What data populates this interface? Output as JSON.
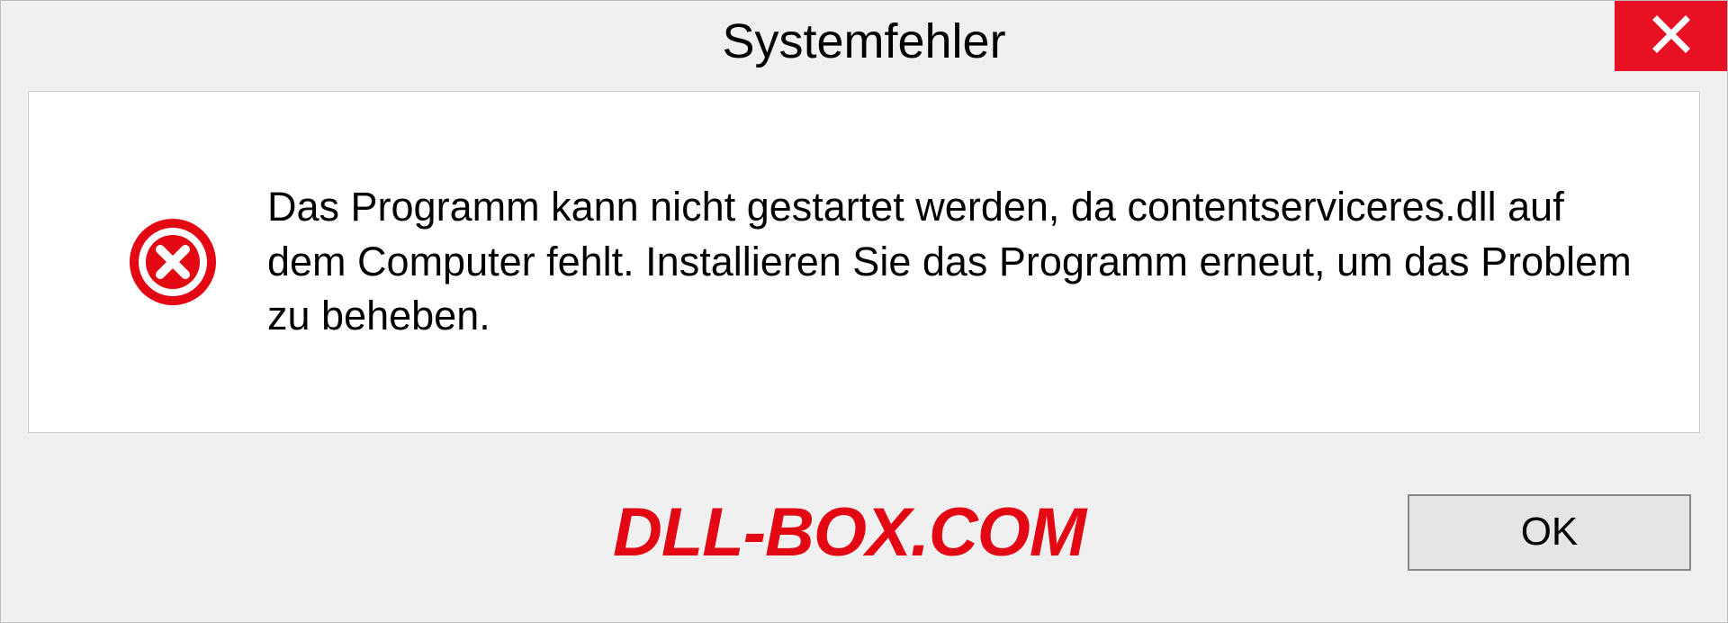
{
  "dialog": {
    "title": "Systemfehler",
    "message": "Das Programm kann nicht gestartet werden, da contentserviceres.dll auf dem Computer fehlt. Installieren Sie das Programm erneut, um das Problem zu beheben.",
    "ok_label": "OK"
  },
  "watermark": "DLL-BOX.COM",
  "colors": {
    "close_red": "#e81123",
    "icon_red": "#e30613",
    "watermark_red": "#e30613"
  }
}
